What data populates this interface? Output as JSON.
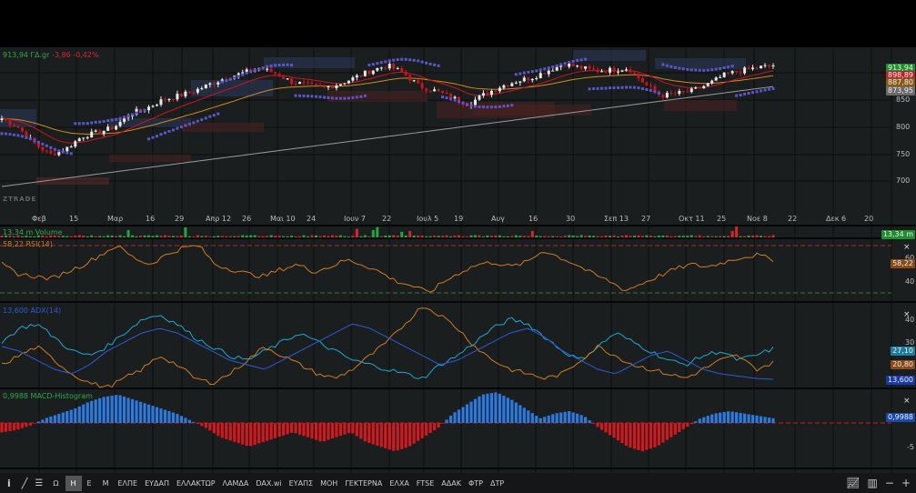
{
  "header": {
    "price": "913,94",
    "unit": "ΓΔ.gr",
    "change": "-3,86",
    "change_pct": "-0,42%"
  },
  "price_tags": [
    {
      "value": "913,94",
      "color": "#1e8e2e"
    },
    {
      "value": "898,89",
      "color": "#b3262a"
    },
    {
      "value": "887,80",
      "color": "#8a5a14"
    },
    {
      "value": "873,95",
      "color": "#6b6b6b"
    }
  ],
  "price_axis": [
    "850",
    "800",
    "750",
    "700"
  ],
  "x_axis": [
    "Φεβ",
    "15",
    "Μαρ",
    "16",
    "29",
    "Απρ 12",
    "26",
    "Μαι 10",
    "24",
    "Ιουν 7",
    "22",
    "Ιουλ 5",
    "19",
    "Αυγ",
    "16",
    "30",
    "Σεπ 13",
    "27",
    "Οκτ 11",
    "25",
    "Νοε 8",
    "22",
    "Δεκ 6",
    "20"
  ],
  "watermark": "ZTRADE",
  "volume": {
    "label": "13,34 m Volume",
    "tag": "13,34 m"
  },
  "rsi": {
    "label": "58,22 RSI(14)",
    "tag": "58,22",
    "axis": [
      "60",
      "40"
    ]
  },
  "adx": {
    "label": "13,600 ADX(14)",
    "tags": [
      "27,10",
      "20,80",
      "13,600"
    ],
    "axis": [
      "40",
      "30"
    ]
  },
  "macd": {
    "label": "0,9988 MACD-Histogram",
    "tag": "0,9988",
    "axis": [
      "-5"
    ]
  },
  "close_icon": "×",
  "toolbar": {
    "tools": [
      "info-icon",
      "draw-line-icon",
      "indicators-icon"
    ],
    "periods": [
      "Ω",
      "Η",
      "Ε",
      "Μ"
    ],
    "active_period": "Η",
    "symbols": [
      "ΕΛΠΕ",
      "ΕΥΔΑΠ",
      "ΕΛΛΑΚΤΩΡ",
      "ΛΑΜΔΑ",
      "DAX.wi",
      "ΕΥΑΠΣ",
      "ΜΟΗ",
      "ΓΕΚΤΕΡΝΑ",
      "ΕΛΧΑ",
      "FTSE",
      "ΑΔΑΚ",
      "ΦΤΡ",
      "ΔΤΡ"
    ],
    "right": [
      "chart-type-icon",
      "bar-chart-icon",
      "zoom-out-icon",
      "zoom-in-icon"
    ]
  },
  "colors": {
    "up": "#e8e8e8",
    "down": "#c8161e",
    "sar": "#5a55c8",
    "sma200": "#9a9a9a",
    "ema_fast": "#c8161e",
    "ema_slow": "#d08a1e",
    "rsi": "#d07a20",
    "adx": "#2a5ad8",
    "pdi": "#1aa8d0",
    "mdi": "#d07a20",
    "macd_pos": "#2a7ae0",
    "macd_neg": "#d01a20"
  },
  "chart_data": {
    "type": "line",
    "title": "913,94 ΓΔ.gr",
    "price_close": [
      816,
      800,
      770,
      749,
      760,
      783,
      790,
      800,
      825,
      835,
      850,
      858,
      867,
      880,
      892,
      900,
      909,
      900,
      884,
      878,
      872,
      880,
      892,
      905,
      914,
      900,
      875,
      867,
      855,
      842,
      860,
      875,
      885,
      892,
      905,
      917,
      910,
      904,
      906,
      909,
      880,
      858,
      862,
      867,
      880,
      897,
      904,
      910,
      913.94
    ],
    "sma200": [
      690,
      875
    ],
    "ylim": [
      680,
      930
    ],
    "rsi": [
      54,
      46,
      44,
      42,
      48,
      54,
      62,
      70,
      60,
      54,
      62,
      68,
      70,
      54,
      50,
      46,
      44,
      50,
      54,
      48,
      52,
      58,
      54,
      48,
      40,
      36,
      30,
      40,
      48,
      54,
      56,
      52,
      56,
      66,
      60,
      54,
      46,
      40,
      32,
      38,
      44,
      50,
      54,
      52,
      56,
      60,
      62,
      58.22
    ],
    "adx_line": [
      28,
      26,
      22,
      18,
      16,
      20,
      26,
      30,
      34,
      36,
      34,
      30,
      26,
      22,
      20,
      18,
      22,
      26,
      30,
      34,
      38,
      36,
      32,
      28,
      24,
      20,
      22,
      26,
      30,
      34,
      36,
      32,
      26,
      22,
      18,
      16,
      20,
      24,
      26,
      22,
      18,
      16,
      15,
      14,
      13.6
    ],
    "plus_di": [
      30,
      36,
      38,
      32,
      26,
      24,
      28,
      34,
      40,
      42,
      38,
      32,
      28,
      24,
      22,
      26,
      30,
      34,
      30,
      26,
      22,
      20,
      18,
      16,
      14,
      20,
      24,
      30,
      36,
      40,
      38,
      32,
      26,
      22,
      28,
      34,
      30,
      26,
      22,
      20,
      24,
      26,
      22,
      24,
      27.1
    ],
    "minus_di": [
      20,
      24,
      28,
      22,
      16,
      12,
      10,
      14,
      18,
      24,
      20,
      14,
      12,
      16,
      22,
      28,
      24,
      20,
      16,
      14,
      18,
      24,
      30,
      38,
      46,
      42,
      36,
      28,
      22,
      18,
      16,
      14,
      16,
      22,
      28,
      24,
      20,
      18,
      16,
      14,
      18,
      22,
      24,
      18,
      20.8
    ],
    "macd_hist": [
      -2,
      -1.5,
      -0.5,
      1,
      2,
      3,
      4.5,
      5.5,
      6,
      5,
      4,
      3,
      2,
      0.5,
      -1,
      -3,
      -4,
      -5,
      -4,
      -3,
      -2,
      -3,
      -4,
      -3,
      -2,
      -4,
      -5,
      -6,
      -5,
      -3,
      -1,
      2,
      4,
      6,
      6.5,
      5,
      3,
      1,
      2,
      2.5,
      1.5,
      -1,
      -3,
      -5,
      -6,
      -5,
      -3,
      -1,
      1,
      2,
      2.5,
      2,
      1.5,
      0.9988
    ]
  }
}
